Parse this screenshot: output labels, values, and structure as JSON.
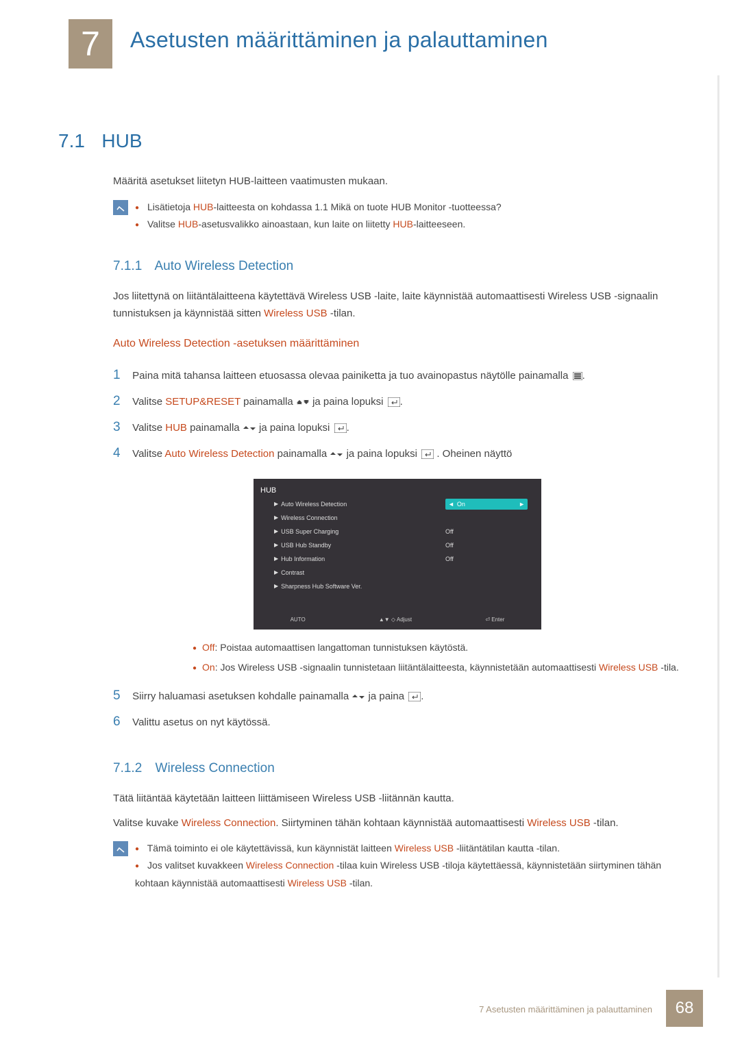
{
  "chapter": {
    "number": "7",
    "title": "Asetusten määrittäminen ja palauttaminen"
  },
  "section": {
    "number": "7.1",
    "title": "HUB"
  },
  "intro": "Määritä asetukset liitetyn HUB-laitteen vaatimusten mukaan.",
  "note1": {
    "line1_a": "Lisätietoja ",
    "line1_b": "HUB",
    "line1_c": "-laitteesta on kohdassa 1.1 Mikä on tuote HUB Monitor -tuotteessa?",
    "line2_a": "Valitse ",
    "line2_b": "HUB",
    "line2_c": "-asetusvalikko ainoastaan, kun laite on liitetty ",
    "line2_d": "HUB",
    "line2_e": "-laitteeseen."
  },
  "subsection1": {
    "number": "7.1.1",
    "title": "Auto Wireless Detection"
  },
  "awd_intro": "Jos liitettynä on liitäntälaitteena käytettävä Wireless USB -laite, laite käynnistää automaattisesti Wireless USB -signaalin tunnistuksen ja käynnistää sitten ",
  "awd_intro_hl": "Wireless USB",
  "awd_intro_end": " -tilan.",
  "awd_head": "Auto Wireless Detection -asetuksen määrittäminen",
  "steps": {
    "s1": "Paina mitä tahansa laitteen etuosassa olevaa painiketta ja tuo avainopastus näytölle painamalla ",
    "s2_a": "Valitse ",
    "s2_b": "SETUP&RESET",
    "s2_c": " painamalla ",
    "s2_d": " ja paina lopuksi ",
    "s3_a": "Valitse ",
    "s3_b": "HUB",
    "s3_c": " painamalla ",
    "s3_d": " ja paina lopuksi ",
    "s4_a": "Valitse ",
    "s4_b": "Auto Wireless Detection",
    "s4_c": " painamalla ",
    "s4_d": " ja paina lopuksi ",
    "s4_e": ". Oheinen näyttö",
    "s5": "Siirry haluamasi asetuksen kohdalle painamalla ",
    "s5_b": " ja paina ",
    "s6": "Valittu asetus on nyt käytössä."
  },
  "screenshot": {
    "title": "HUB",
    "rows": [
      {
        "label": "Auto Wireless Detection",
        "value": "On",
        "hl": true
      },
      {
        "label": "Wireless Connection",
        "value": "",
        "hl": false
      },
      {
        "label": "USB Super Charging",
        "value": "Off",
        "hl": false
      },
      {
        "label": "USB Hub Standby",
        "value": "Off",
        "hl": false
      },
      {
        "label": "Hub Information",
        "value": "Off",
        "hl": false
      },
      {
        "label": "Contrast",
        "value": "",
        "hl": false
      },
      {
        "label": "Sharpness Hub Software Ver.",
        "value": "",
        "hl": false
      }
    ],
    "bottom": [
      "AUTO",
      "▲▼ ◇ Adjust",
      "⏎ Enter"
    ]
  },
  "opt_bullets": {
    "b1_a": "Off",
    "b1_b": ": Poistaa automaattisen langattoman tunnistuksen käytöstä.",
    "b2_a": "On",
    "b2_b": ": Jos Wireless USB -signaalin tunnistetaan liitäntälaitteesta, käynnistetään automaattisesti ",
    "b2_c": "Wireless USB",
    "b2_d": " -tila."
  },
  "subsection2": {
    "number": "7.1.2",
    "title": "Wireless Connection"
  },
  "wc_intro": "Tätä liitäntää käytetään laitteen liittämiseen Wireless USB -liitännän kautta.",
  "wc_line_a": "Valitse kuvake ",
  "wc_line_b": "Wireless Connection",
  "wc_line_c": ". Siirtyminen tähän kohtaan käynnistää automaattisesti ",
  "wc_line_d": "Wireless USB",
  "wc_line_e": " -tilan.",
  "note2": {
    "l1_a": "Tämä toiminto ei ole käytettävissä, kun käynnistät laitteen ",
    "l1_b": "Wireless USB",
    "l1_c": " -liitäntätilan kautta -tilan.",
    "l2_a": "Jos valitset kuvakkeen ",
    "l2_b": "Wireless Connection",
    "l2_c": " -tilaa kuin Wireless USB -tiloja käytettäessä, käynnistetään siirtyminen tähän kohtaan käynnistää automaattisesti ",
    "l2_d": "Wireless USB",
    "l2_e": " -tilan."
  },
  "footer": "7 Asetusten määrittäminen ja palauttaminen",
  "page": "68"
}
